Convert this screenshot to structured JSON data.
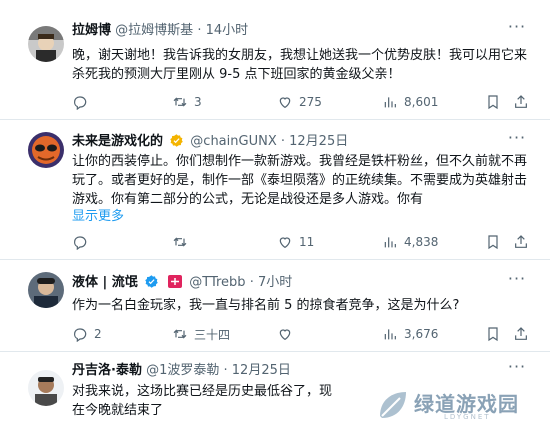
{
  "colors": {
    "accent": "#1d9bf0",
    "muted": "#536471",
    "text": "#0f1419",
    "border": "#e1e8ed",
    "gold": "#f4b400",
    "red": "#e0245e"
  },
  "tweets": [
    {
      "name": "拉姆博",
      "handle": "@拉姆博斯基",
      "time": "· 14小时",
      "text": "晚，谢天谢地！我告诉我的女朋友，我想让她送我一个优势皮肤！我可以用它来杀死我的预测大厅里刚从 9-5 点下班回家的黄金级父亲！",
      "replies": "",
      "retweets": "3",
      "likes": "275",
      "views": "8,601"
    },
    {
      "name": "未来是游戏化的",
      "handle": "@chainGUNX",
      "time": "· 12月25日",
      "text": "让你的西装停止。你们想制作一款新游戏。我曾经是铁杆粉丝，但不久前就不再玩了。或者更好的是，制作一部《泰坦陨落》的正统续集。不需要成为英雄射击游戏。你有第二部分的公式，无论是战役还是多人游戏。你有",
      "show_more": "显示更多",
      "replies": "",
      "retweets": "",
      "likes": "11",
      "views": "4,838"
    },
    {
      "name": "液体 | 流氓",
      "handle": "@TTrebb",
      "time": "· 7小时",
      "text": "作为一名白金玩家，我一直与排名前 5 的掠食者竞争，这是为什么?",
      "replies": "2",
      "retweets": "三十四",
      "likes": "",
      "views": "3,676"
    },
    {
      "name": "丹吉洛·泰勒",
      "handle": "@1波罗泰勒",
      "time": "· 12月25日",
      "text": "对我来说，这场比赛已经是历史最低谷了，现在今晚就结束了"
    }
  ],
  "icons": {
    "reply": "reply-icon",
    "retweet": "retweet-icon",
    "like": "heart-icon",
    "views": "views-icon",
    "bookmark": "bookmark-icon",
    "share": "share-icon",
    "more": "more-icon",
    "verified": "verified-badge-icon"
  },
  "watermark": {
    "title": "绿道游戏园",
    "sub": "LDYGNET"
  }
}
